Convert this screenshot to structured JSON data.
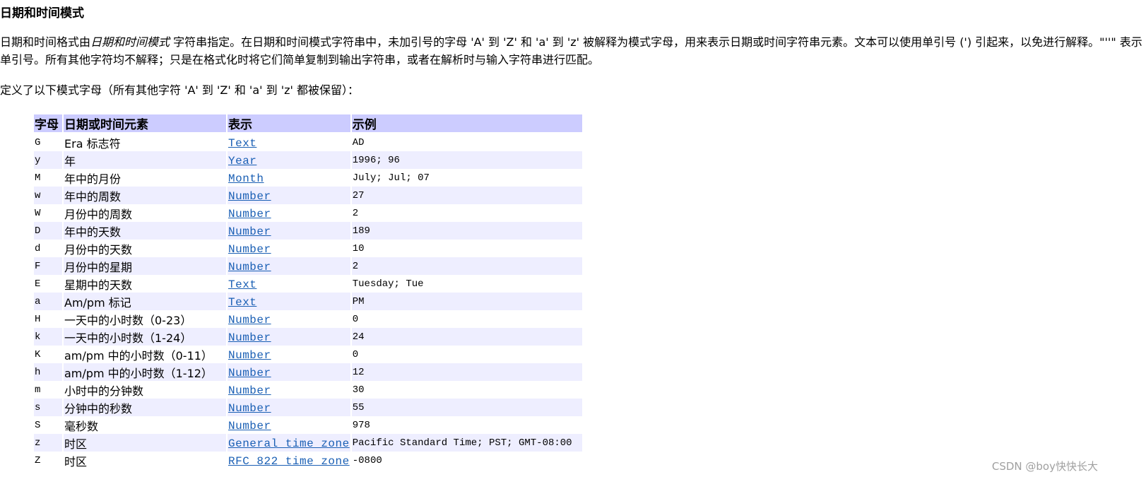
{
  "title": "日期和时间模式",
  "paragraph1": {
    "before_italic": "日期和时间格式由",
    "italic": "日期和时间模式",
    "after_italic": " 字符串指定。在日期和时间模式字符串中，未加引号的字母 'A' 到 'Z' 和 'a' 到 'z' 被解释为模式字母，用来表示日期或时间字符串元素。文本可以使用单引号 (') 引起来，以免进行解释。\"''\" 表示单引号。所有其他字符均不解释；只是在格式化时将它们简单复制到输出字符串，或者在解析时与输入字符串进行匹配。"
  },
  "paragraph2": "定义了以下模式字母（所有其他字符 'A' 到 'Z' 和 'a' 到 'z' 都被保留）：",
  "table": {
    "headers": [
      "字母",
      "日期或时间元素",
      "表示",
      "示例"
    ],
    "rows": [
      {
        "letter": "G",
        "element": "Era 标志符",
        "representation": "Text",
        "example": "AD"
      },
      {
        "letter": "y",
        "element": "年",
        "representation": "Year",
        "example": "1996; 96"
      },
      {
        "letter": "M",
        "element": "年中的月份",
        "representation": "Month",
        "example": "July; Jul; 07"
      },
      {
        "letter": "w",
        "element": "年中的周数",
        "representation": "Number",
        "example": "27"
      },
      {
        "letter": "W",
        "element": "月份中的周数",
        "representation": "Number",
        "example": "2"
      },
      {
        "letter": "D",
        "element": "年中的天数",
        "representation": "Number",
        "example": "189"
      },
      {
        "letter": "d",
        "element": "月份中的天数",
        "representation": "Number",
        "example": "10"
      },
      {
        "letter": "F",
        "element": "月份中的星期",
        "representation": "Number",
        "example": "2"
      },
      {
        "letter": "E",
        "element": "星期中的天数",
        "representation": "Text",
        "example": "Tuesday; Tue"
      },
      {
        "letter": "a",
        "element": "Am/pm 标记",
        "representation": "Text",
        "example": "PM"
      },
      {
        "letter": "H",
        "element": "一天中的小时数（0-23）",
        "representation": "Number",
        "example": "0"
      },
      {
        "letter": "k",
        "element": "一天中的小时数（1-24）",
        "representation": "Number",
        "example": "24"
      },
      {
        "letter": "K",
        "element": "am/pm 中的小时数（0-11）",
        "representation": "Number",
        "example": "0"
      },
      {
        "letter": "h",
        "element": "am/pm 中的小时数（1-12）",
        "representation": "Number",
        "example": "12"
      },
      {
        "letter": "m",
        "element": "小时中的分钟数",
        "representation": "Number",
        "example": "30"
      },
      {
        "letter": "s",
        "element": "分钟中的秒数",
        "representation": "Number",
        "example": "55"
      },
      {
        "letter": "S",
        "element": "毫秒数",
        "representation": "Number",
        "example": "978"
      },
      {
        "letter": "z",
        "element": "时区",
        "representation": "General time zone",
        "example": "Pacific Standard Time; PST; GMT-08:00"
      },
      {
        "letter": "Z",
        "element": "时区",
        "representation": "RFC 822 time zone",
        "example": "-0800"
      }
    ]
  },
  "colors": {
    "header_bg": "#ccccff",
    "alt_row_bg": "#eeeeff",
    "link": "#1a5fb4",
    "watermark": "#a0a0a0"
  },
  "watermark": "CSDN @boy快快长大"
}
